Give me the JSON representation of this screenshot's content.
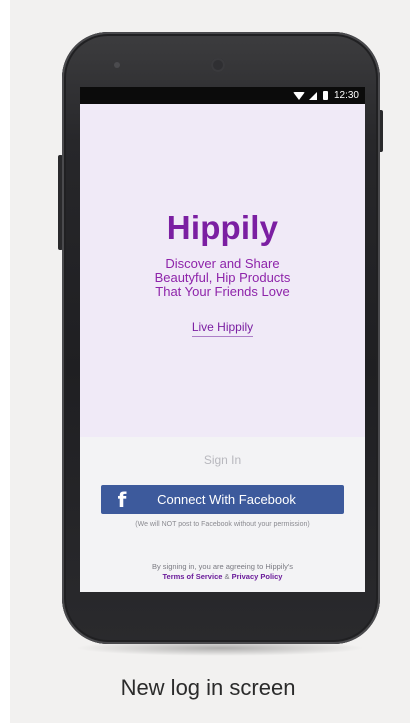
{
  "status_bar": {
    "time": "12:30"
  },
  "app": {
    "brand": "Hippily",
    "tagline_line1": "Discover and Share",
    "tagline_line2": "Beautyful, Hip Products",
    "tagline_line3": "That Your Friends Love",
    "live_link": "Live Hippily"
  },
  "signin": {
    "label": "Sign In",
    "facebook_button": "Connect With Facebook",
    "facebook_icon": "f",
    "facebook_note": "(We will NOT post to Facebook without your permission)",
    "terms_prefix": "By signing in, you are agreeing to Hippily's",
    "terms_link": "Terms of Service",
    "terms_amp": "&",
    "privacy_link": "Privacy Policy"
  },
  "caption": "New log in screen",
  "colors": {
    "brand_purple": "#7b1fa2",
    "facebook_blue": "#3d5a9c",
    "screen_bg": "#f0eaf7"
  },
  "icons": [
    "wifi-icon",
    "signal-icon",
    "battery-icon",
    "facebook-icon",
    "camera-icon"
  ]
}
